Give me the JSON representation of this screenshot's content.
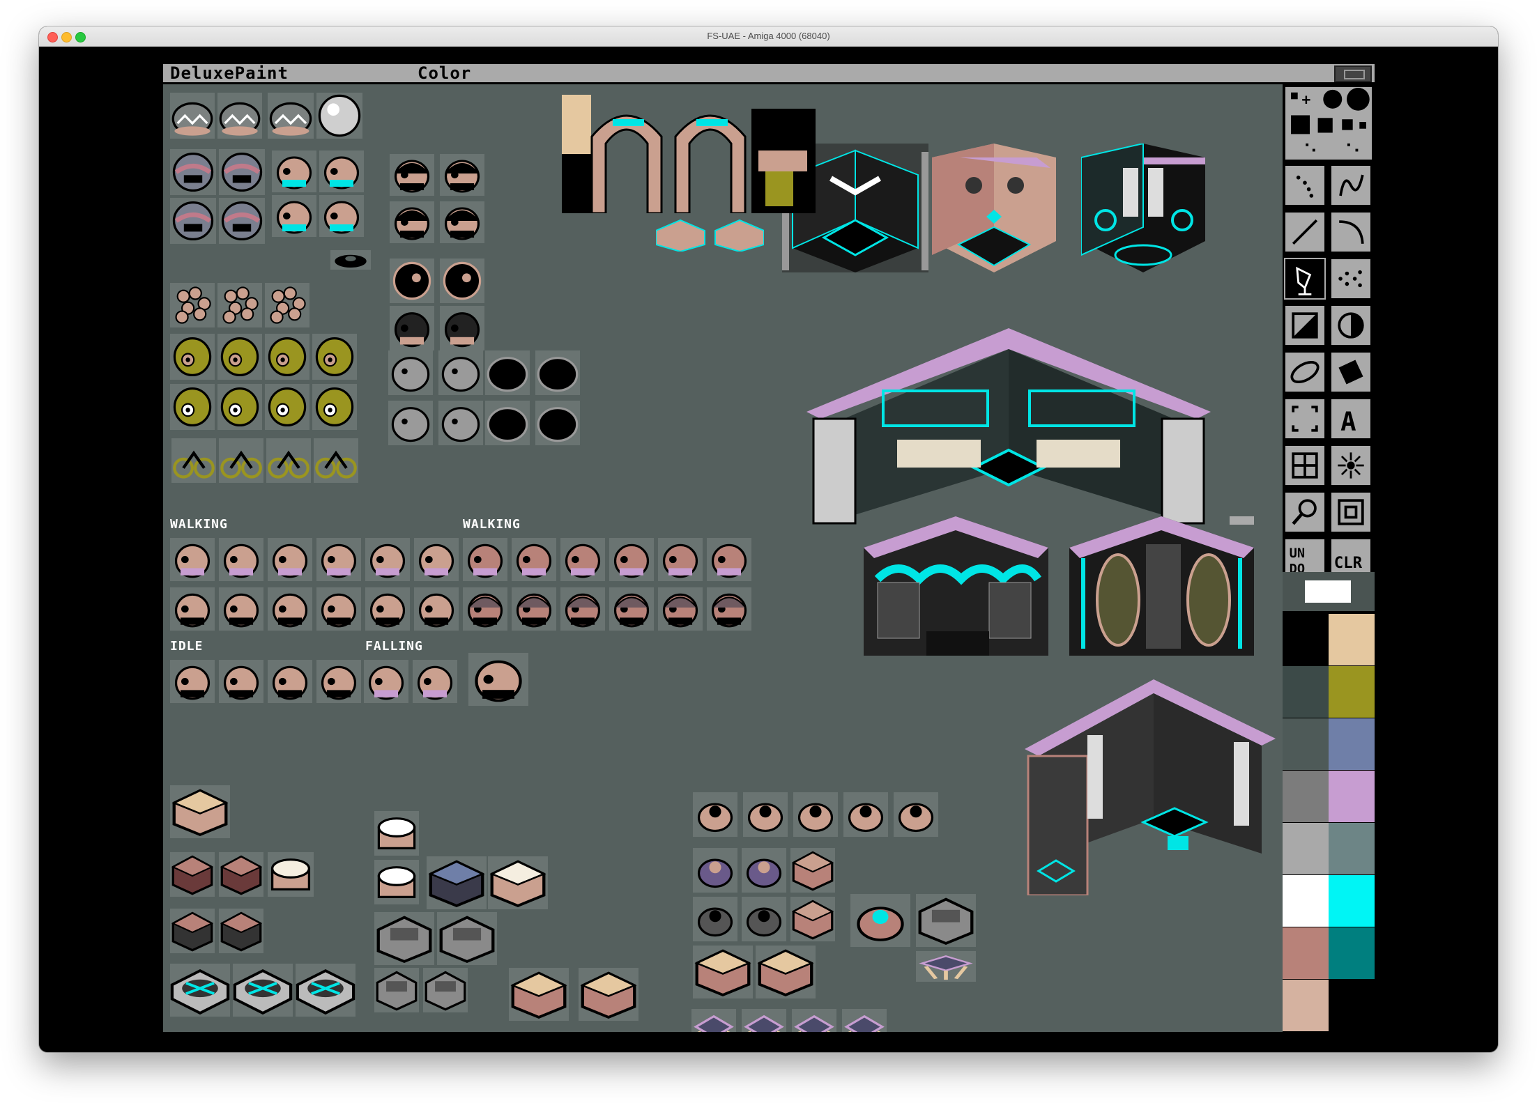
{
  "window": {
    "title": "FS-UAE - Amiga 4000 (68040)"
  },
  "menubar": {
    "app": "DeluxePaint",
    "menu": "Color"
  },
  "labels": {
    "walking_left": "WALKING",
    "walking_right": "WALKING",
    "idle": "IDLE",
    "falling": "FALLING"
  },
  "toolbox": {
    "tools": [
      {
        "name": "brush-size"
      },
      {
        "name": "freehand-dots-icon"
      },
      {
        "name": "freehand-continuous-icon"
      },
      {
        "name": "line-icon"
      },
      {
        "name": "curve-icon"
      },
      {
        "name": "fill-icon"
      },
      {
        "name": "airbrush-icon"
      },
      {
        "name": "rectangle-icon"
      },
      {
        "name": "circle-icon"
      },
      {
        "name": "ellipse-icon"
      },
      {
        "name": "polygon-icon"
      },
      {
        "name": "brush-select-icon"
      },
      {
        "name": "text-icon"
      },
      {
        "name": "grid-icon"
      },
      {
        "name": "symmetry-icon"
      },
      {
        "name": "magnify-icon"
      },
      {
        "name": "zoom-icon"
      },
      {
        "name": "undo-icon"
      },
      {
        "name": "clear-icon"
      }
    ],
    "undo_label": "UN DO",
    "clear_label": "CLR"
  },
  "palette": [
    "#000000",
    "#e5c8a0",
    "#3c4a48",
    "#9a9520",
    "#4e5a58",
    "#6f7fa8",
    "#7c7c7c",
    "#c79dd1",
    "#a9a9a9",
    "#6d8586",
    "#ffffff",
    "#00f5f5",
    "#b88279",
    "#007f7f",
    "#d5b2a0",
    "#000000"
  ],
  "colors": {
    "background": "#55605e",
    "menubar": "#aaaaaa",
    "cyan": "#00e5e5",
    "skin": "#c99a8c",
    "tan": "#e5c8a0",
    "olive": "#9a9520",
    "lavender": "#c79dd1"
  }
}
